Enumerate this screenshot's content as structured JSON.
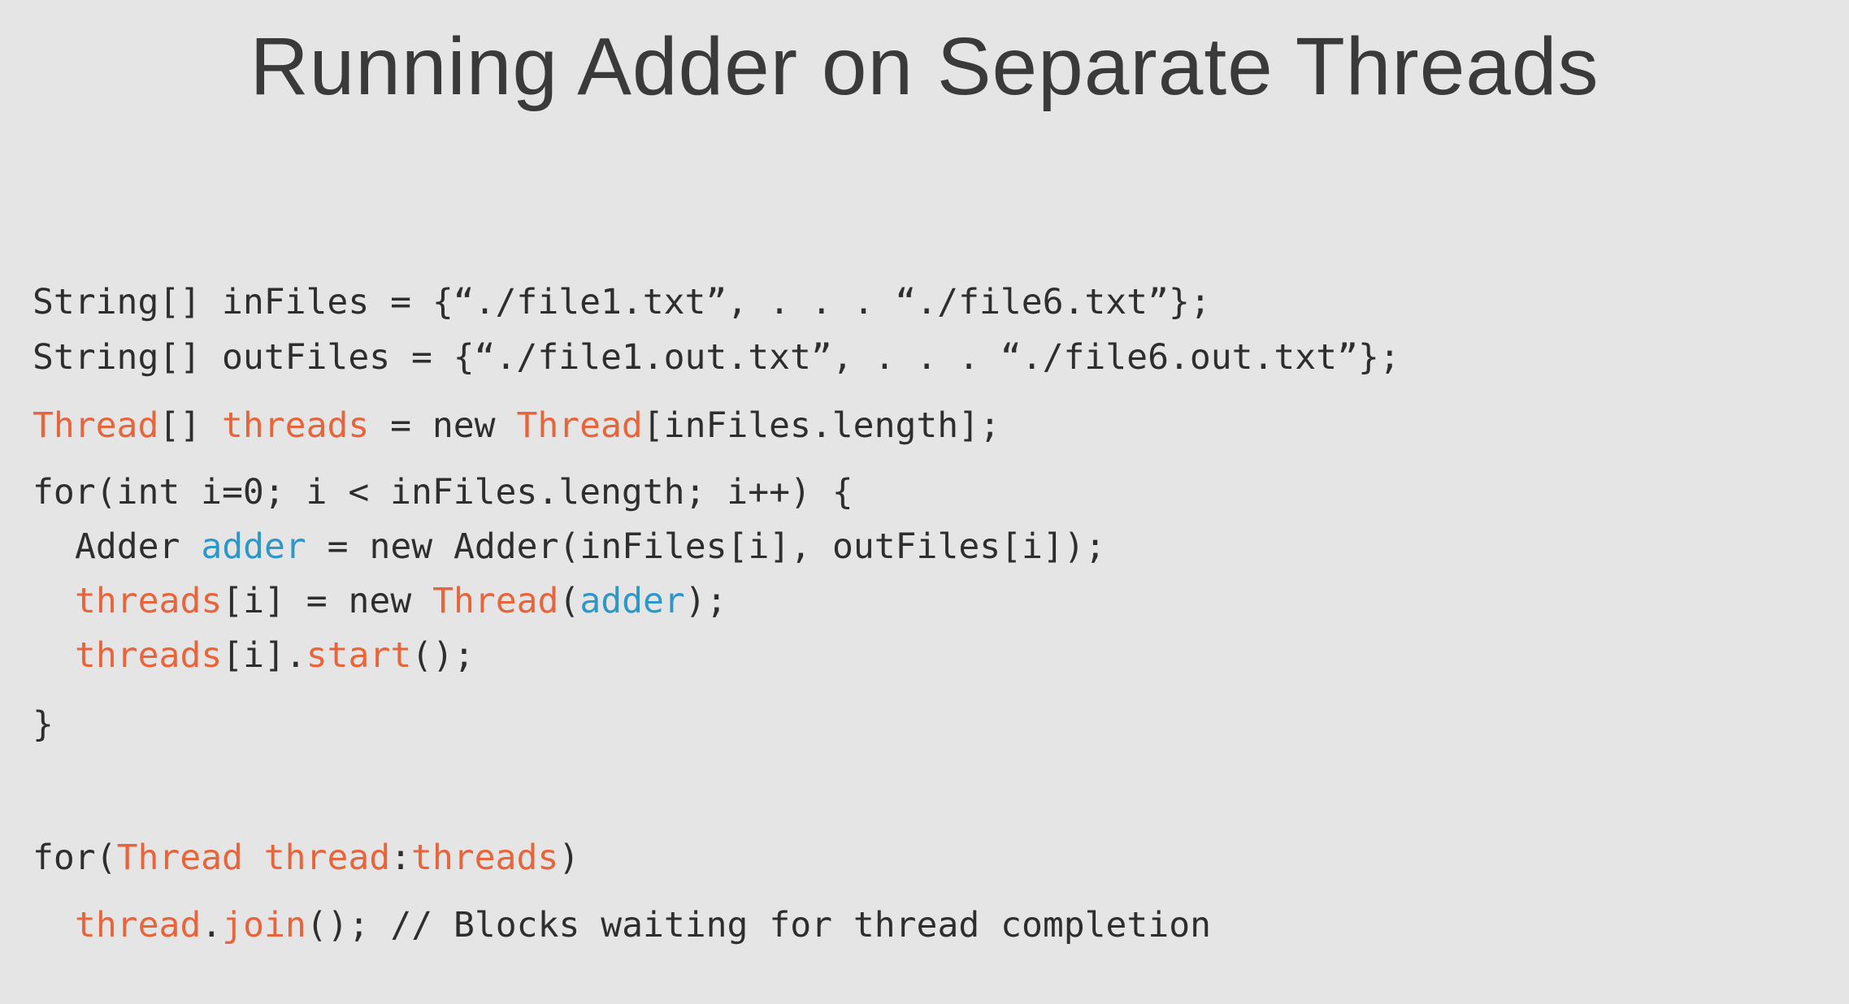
{
  "title": "Running Adder on Separate Threads",
  "colors": {
    "background": "#e5e5e5",
    "text": "#2e2e2e",
    "orange": "#e8643a",
    "blue": "#2d98c8"
  },
  "code": {
    "lines": [
      {
        "tokens": [
          {
            "text": "String[] inFiles = {“./file1.txt”, . . . “./file6.txt”};",
            "style": "plain"
          }
        ]
      },
      {
        "tokens": [
          {
            "text": "String[] outFiles = {“./file1.out.txt”, . . . “./file6.out.txt”};",
            "style": "plain"
          }
        ]
      },
      {
        "tokens": [
          {
            "text": "Thread",
            "style": "orange"
          },
          {
            "text": "[] ",
            "style": "plain"
          },
          {
            "text": "threads",
            "style": "orange"
          },
          {
            "text": " = new ",
            "style": "plain"
          },
          {
            "text": "Thread",
            "style": "orange"
          },
          {
            "text": "[inFiles.length];",
            "style": "plain"
          }
        ]
      },
      {
        "tokens": [
          {
            "text": "for(int i=0; i < inFiles.length; i++) {",
            "style": "plain"
          }
        ]
      },
      {
        "tokens": [
          {
            "text": "Adder ",
            "style": "plain"
          },
          {
            "text": "adder",
            "style": "blue"
          },
          {
            "text": " = new Adder(inFiles[i], outFiles[i]);",
            "style": "plain"
          }
        ]
      },
      {
        "tokens": [
          {
            "text": "threads",
            "style": "orange"
          },
          {
            "text": "[i] = new ",
            "style": "plain"
          },
          {
            "text": "Thread",
            "style": "orange"
          },
          {
            "text": "(",
            "style": "plain"
          },
          {
            "text": "adder",
            "style": "blue"
          },
          {
            "text": ");",
            "style": "plain"
          }
        ]
      },
      {
        "tokens": [
          {
            "text": "threads",
            "style": "orange"
          },
          {
            "text": "[i].",
            "style": "plain"
          },
          {
            "text": "start",
            "style": "orange"
          },
          {
            "text": "();",
            "style": "plain"
          }
        ]
      },
      {
        "tokens": [
          {
            "text": "}",
            "style": "plain"
          }
        ]
      },
      {
        "tokens": [
          {
            "text": "for(",
            "style": "plain"
          },
          {
            "text": "Thread thread",
            "style": "orange"
          },
          {
            "text": ":",
            "style": "plain"
          },
          {
            "text": "threads",
            "style": "orange"
          },
          {
            "text": ")",
            "style": "plain"
          }
        ]
      },
      {
        "tokens": [
          {
            "text": "thread",
            "style": "orange"
          },
          {
            "text": ".",
            "style": "plain"
          },
          {
            "text": "join",
            "style": "orange"
          },
          {
            "text": "(); // Blocks waiting for thread completion",
            "style": "plain"
          }
        ]
      }
    ]
  }
}
